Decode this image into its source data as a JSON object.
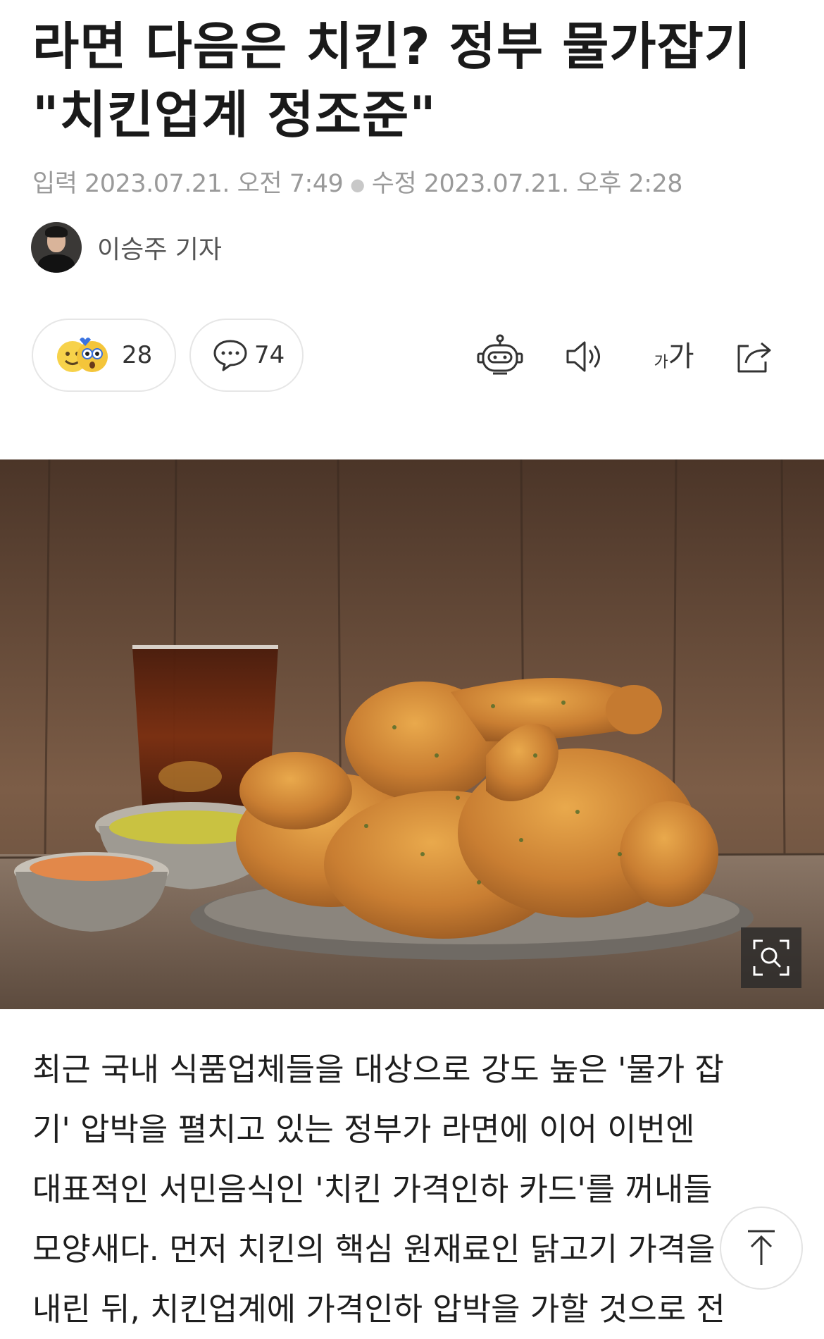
{
  "article": {
    "headline_lines": [
      "라면 다음은 치킨? 정부 물가잡기",
      "\"치킨업계 정조준\""
    ],
    "published": "입력 2023.07.21. 오전 7:49",
    "modified": "수정 2023.07.21. 오후 2:28",
    "author": "이승주 기자",
    "body_lines": [
      "최근 국내 식품업체들을 대상으로 강도 높은 '물가 잡",
      "기' 압박을 펼치고 있는 정부가 라면에 이어 이번엔",
      "대표적인 서민음식인 '치킨 가격인하 카드'를 꺼내들",
      "모양새다. 먼저 치킨의 핵심 원재료인 닭고기 가격을",
      "내린 뒤, 치킨업계에 가격인하 압박을 가할 것으로 전"
    ]
  },
  "actions": {
    "reaction_count": "28",
    "comment_count": "74",
    "font_size_label_small": "가",
    "font_size_label_large": "가"
  },
  "icons": {
    "reaction": "emoji-reaction-icon",
    "comment": "speech-bubble-icon",
    "summary": "robot-icon",
    "tts": "speaker-icon",
    "font_size": "font-size-icon",
    "share": "share-icon",
    "zoom": "image-zoom-icon",
    "scroll_top": "arrow-up-icon"
  },
  "colors": {
    "text": "#1e1e1e",
    "meta": "#9a9a9a",
    "border": "#e6e6e6"
  }
}
